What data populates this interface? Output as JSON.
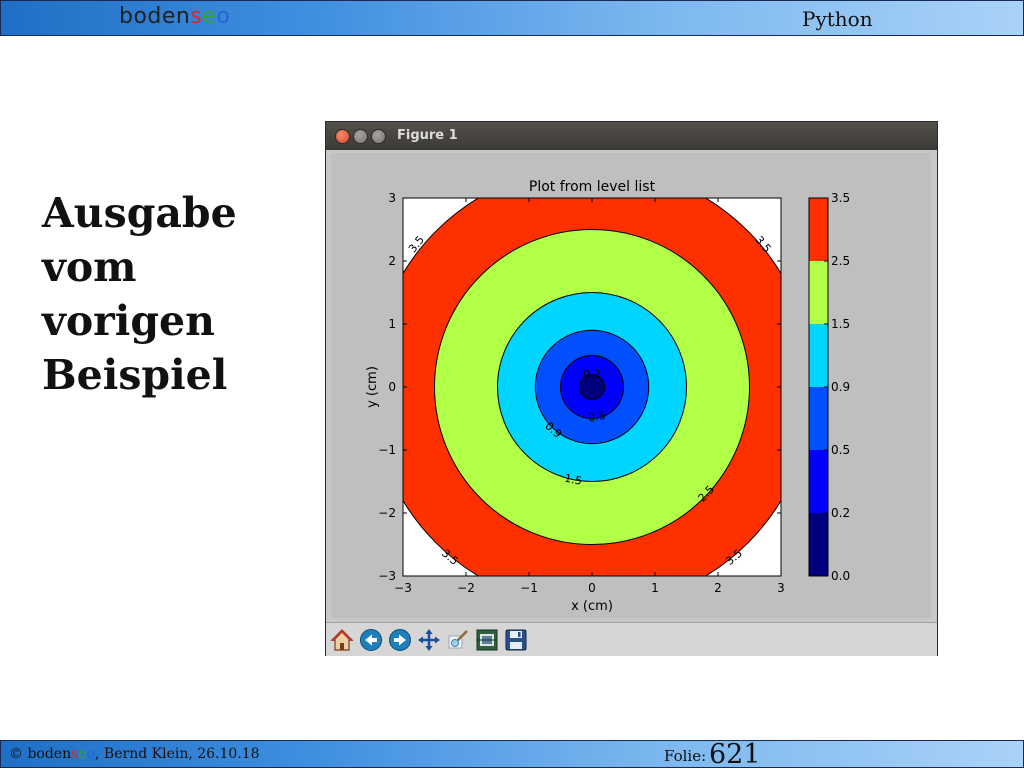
{
  "header": {
    "brand_parts": [
      "boden",
      "s",
      "e",
      "o"
    ],
    "topic": "Python"
  },
  "slide": {
    "heading_lines": [
      "Ausgabe",
      "vom",
      "vorigen",
      "Beispiel"
    ]
  },
  "footer": {
    "copyright_prefix": "© boden",
    "copyright_s": "s",
    "copyright_e": "e",
    "copyright_o": "o",
    "copyright_rest": ", Bernd Klein, 26.10.18",
    "slide_label": "Folie:",
    "slide_number": "621"
  },
  "window": {
    "title": "Figure 1",
    "controls": [
      "close-icon",
      "minimize-icon",
      "maximize-icon"
    ]
  },
  "toolbar": {
    "icons": [
      "home-icon",
      "back-icon",
      "forward-icon",
      "pan-icon",
      "zoom-icon",
      "subplots-icon",
      "save-icon"
    ]
  },
  "colors": {
    "level_fills": [
      "#00007f",
      "#0000ff",
      "#0050ff",
      "#00d5ff",
      "#b2ff48",
      "#ff3000"
    ],
    "figure_bg": "#bfbfbf"
  },
  "chart_data": {
    "type": "contour-filled",
    "title": "Plot from level list",
    "xlabel": "x (cm)",
    "ylabel": "y (cm)",
    "xlim": [
      -3,
      3
    ],
    "ylim": [
      -3,
      3
    ],
    "xticks": [
      -3,
      -2,
      -1,
      0,
      1,
      2,
      3
    ],
    "yticks": [
      -3,
      -2,
      -1,
      0,
      1,
      2,
      3
    ],
    "function": "sqrt(x^2 + y^2)",
    "levels": [
      0.0,
      0.2,
      0.5,
      0.9,
      1.5,
      2.5,
      3.5
    ],
    "colorbar_ticks": [
      "0.0",
      "0.2",
      "0.5",
      "0.9",
      "1.5",
      "2.5",
      "3.5"
    ],
    "contour_labels": [
      {
        "text": "0.2",
        "x": 0.0,
        "y": 0.2
      },
      {
        "text": "0.5",
        "x": 0.08,
        "y": -0.48
      },
      {
        "text": "0.9",
        "x": -0.62,
        "y": -0.69
      },
      {
        "text": "1.5",
        "x": -0.3,
        "y": -1.48
      },
      {
        "text": "2.5",
        "x": 1.82,
        "y": -1.7
      },
      {
        "text": "3.5",
        "x": -2.78,
        "y": 2.26
      },
      {
        "text": "3.5",
        "x": 2.71,
        "y": 2.26
      },
      {
        "text": "3.5",
        "x": -2.26,
        "y": -2.71
      },
      {
        "text": "3.5",
        "x": 2.26,
        "y": -2.71
      }
    ]
  }
}
